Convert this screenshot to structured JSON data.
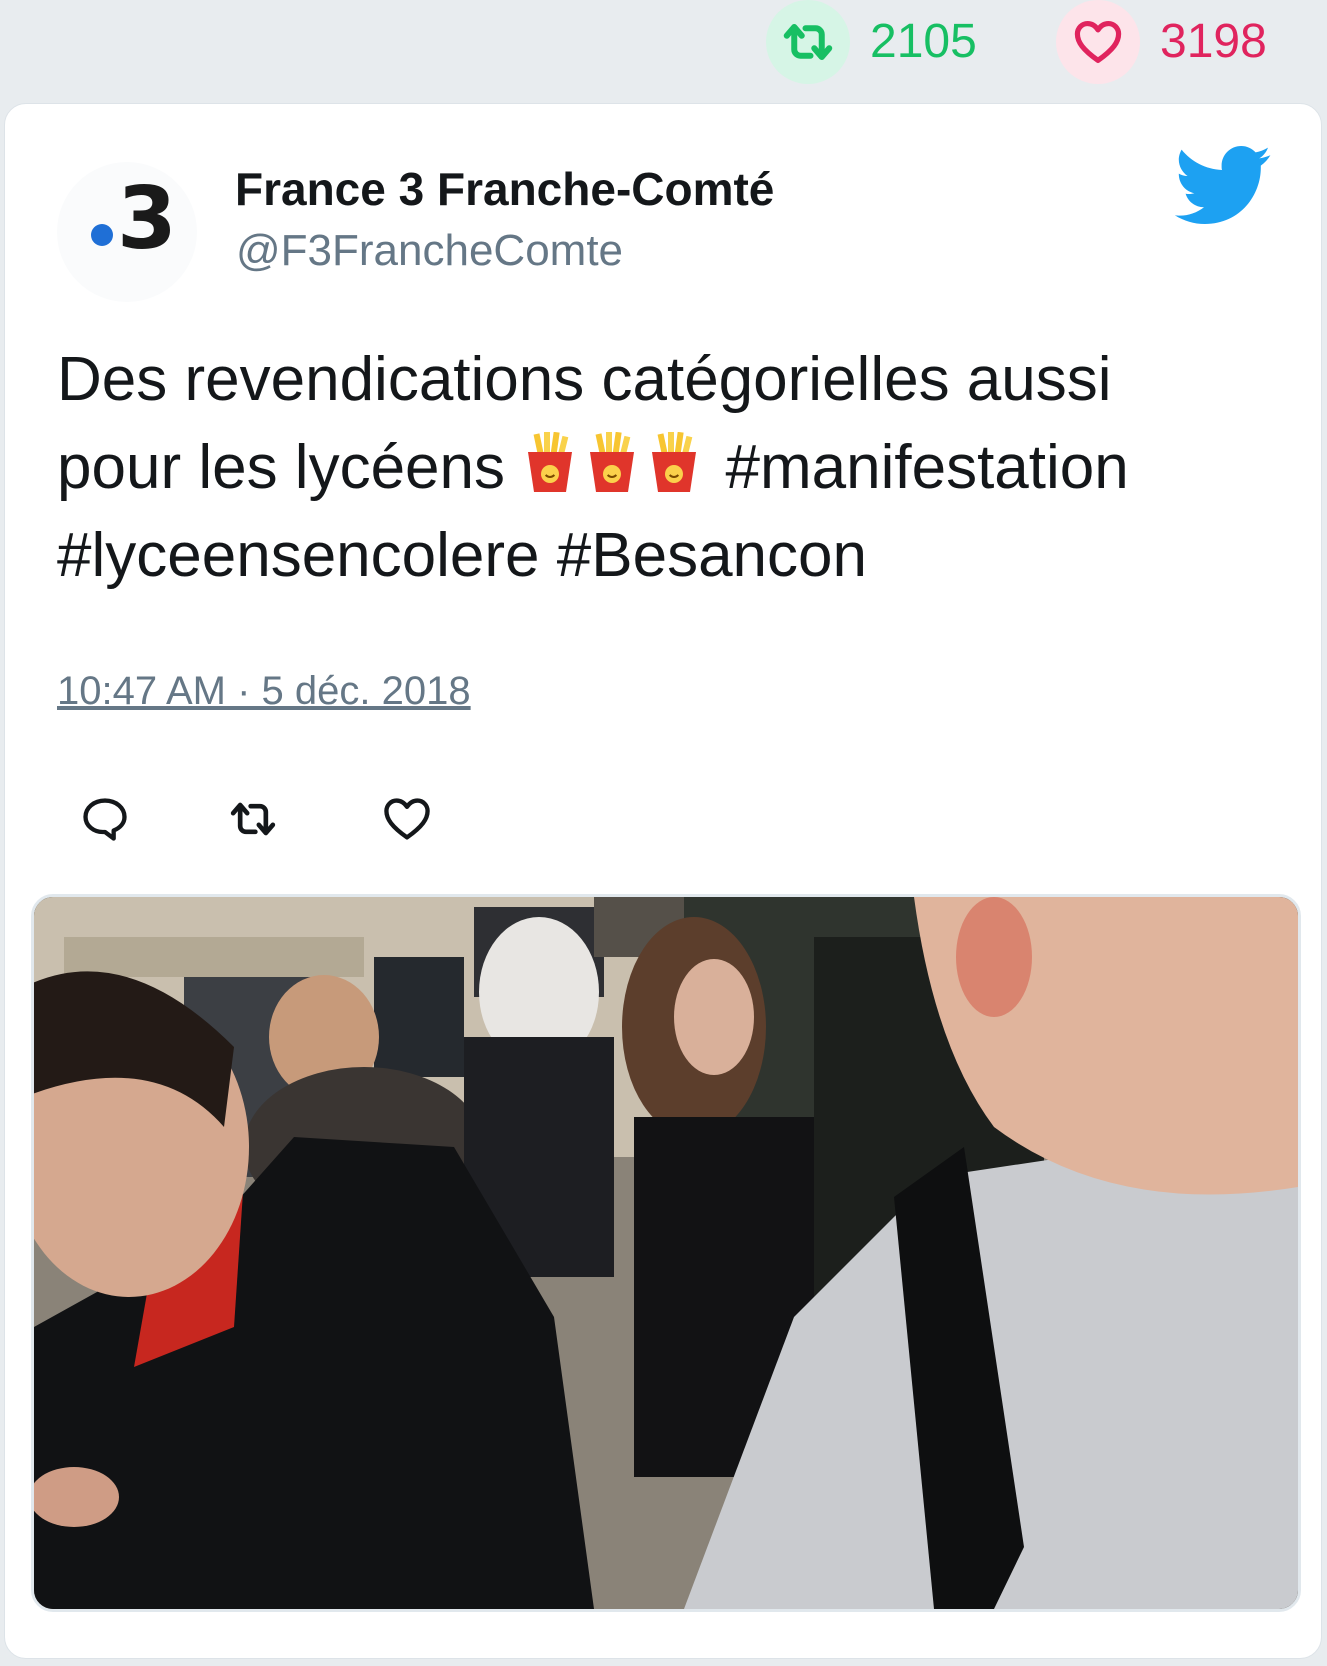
{
  "stats": {
    "retweets": "2105",
    "likes": "3198",
    "retweet_icon": "retweet-icon",
    "like_icon": "heart-icon"
  },
  "tweet": {
    "author": {
      "name": "France 3 Franche-Comté",
      "handle": "@F3FrancheComte",
      "avatar_text": "3"
    },
    "text_line1": "Des revendications catégorielles aussi",
    "text_line2_prefix": "pour les lycéens",
    "text_line2_suffix": "#manifestation",
    "text_line3": "#lyceensencolere #Besancon",
    "emoji": [
      "french-fries-emoji",
      "french-fries-emoji",
      "french-fries-emoji"
    ],
    "timestamp": "10:47 AM · 5 déc. 2018",
    "actions": [
      "reply-icon",
      "retweet-icon",
      "like-icon"
    ],
    "media": "photo-crowd-of-students"
  },
  "colors": {
    "retweet_green": "#17bf63",
    "like_red": "#e0245e",
    "twitter_blue": "#1da1f2",
    "secondary_text": "#657786",
    "background": "#e8ecef"
  }
}
